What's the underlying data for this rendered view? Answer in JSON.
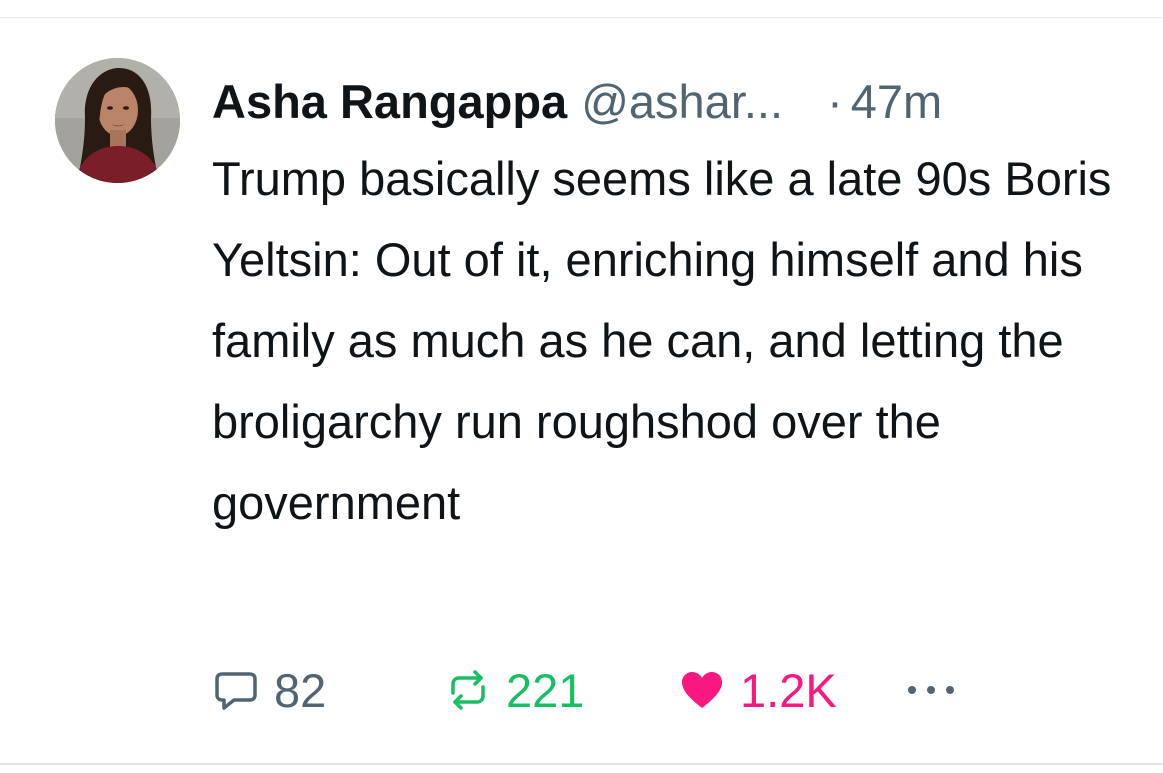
{
  "post": {
    "author": {
      "display_name": "Asha Rangappa",
      "handle": "@ashar...",
      "avatar_icon": "profile-photo"
    },
    "separator": "·",
    "time": "47m",
    "text": "Trump basically seems like a late 90s Boris Yeltsin: Out of it, enriching himself and his family as much as he can, and letting the broligarchy run roughshod over the government",
    "actions": {
      "reply": {
        "icon": "reply-icon",
        "count": "82"
      },
      "repost": {
        "icon": "repost-icon",
        "count": "221",
        "color": "#17bf63"
      },
      "like": {
        "icon": "heart-icon",
        "count": "1.2K",
        "color": "#f91880"
      },
      "more": {
        "icon": "more-icon"
      }
    }
  }
}
